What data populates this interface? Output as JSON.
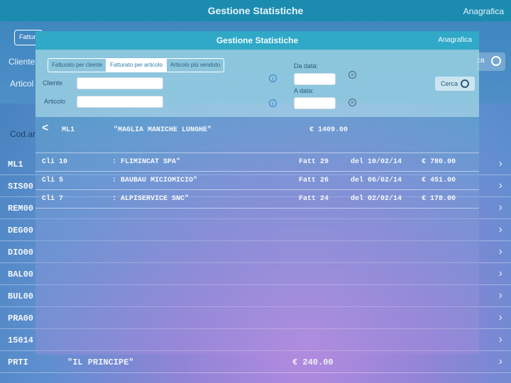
{
  "background": {
    "title": "Gestione Statistiche",
    "anagrafica": "Anagrafica",
    "tab_fragment": "Fattur",
    "cliente_label": "Cliente",
    "articolo_label": "Articol",
    "search_fragment": "ca",
    "column_header": "Cod.ar",
    "rows": [
      {
        "code": "ML1"
      },
      {
        "code": "SIS00"
      },
      {
        "code": "REM00"
      },
      {
        "code": "DEG00"
      },
      {
        "code": "DIO00"
      },
      {
        "code": "BAL00"
      },
      {
        "code": "BUL00"
      },
      {
        "code": "PRA00"
      },
      {
        "code": "15014"
      },
      {
        "code": "PRTI",
        "desc": "\"IL PRINCIPE\"",
        "amount": "€ 240.00"
      }
    ]
  },
  "modal": {
    "title": "Gestione Statistiche",
    "anagrafica": "Anagrafica",
    "tabs": [
      {
        "label": "Fatturato per cliente",
        "active": false
      },
      {
        "label": "Fatturato per articolo",
        "active": true
      },
      {
        "label": "Articolo più venduto",
        "active": false
      }
    ],
    "cliente_label": "Cliente",
    "articolo_label": "Articolo",
    "da_data_label": "Da data:",
    "a_data_label": "A data:",
    "cerca_label": "Cerca",
    "selected": {
      "code": "ML1",
      "desc": "\"MAGLIA MANICHE LUNGHE\"",
      "total": "€ 1409.00"
    },
    "rows": [
      {
        "client": "Cli 10",
        "name": ": FLIMINCAT SPA\"",
        "invoice": "Fatt 29",
        "date": "del 10/02/14",
        "amount": "€ 780.00"
      },
      {
        "client": "Cli 5",
        "name": ": BAUBAU MICIOMICIO\"",
        "invoice": "Fatt 26",
        "date": "del 06/02/14",
        "amount": "€ 451.00"
      },
      {
        "client": "Cli 7",
        "name": ": ALPISERVICE SNC\"",
        "invoice": "Fatt 24",
        "date": "del 02/02/14",
        "amount": "€ 178.00"
      }
    ]
  }
}
